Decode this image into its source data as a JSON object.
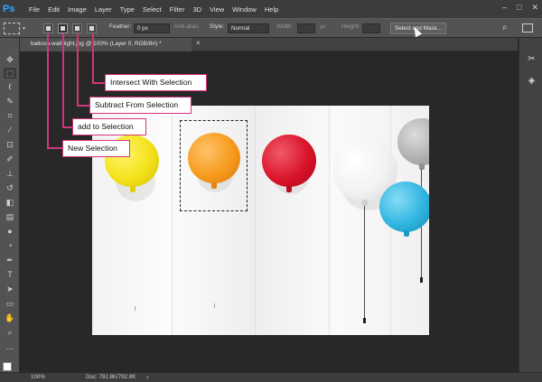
{
  "app": {
    "logo": "Ps"
  },
  "menus": [
    "File",
    "Edit",
    "Image",
    "Layer",
    "Type",
    "Select",
    "Filter",
    "3D",
    "View",
    "Window",
    "Help"
  ],
  "window_controls": [
    "minimize",
    "maximize",
    "close"
  ],
  "options": {
    "feather_label": "Feather:",
    "feather_value": "0 px",
    "antialias_label": "Anti-alias",
    "style_label": "Style:",
    "style_value": "Normal",
    "width_label": "Width:",
    "height_label": "Height:",
    "select_mask": "Select and Mask..."
  },
  "document_tab": {
    "title": "balloon-wall-light.jpg @ 100% (Layer 0, RGB/8#) *",
    "close": "×"
  },
  "status": {
    "zoom": "100%",
    "doc": "Doc: 792.8K/792.8K",
    "arrow": "›"
  },
  "callouts": {
    "intersect": "Intersect With Selection",
    "subtract": "Subtract From Selection",
    "add": "add to Selection",
    "new": "New Selection"
  },
  "colors": {
    "highlight": "#d4347c",
    "foreground": "#ffffff",
    "background": "#ffffff",
    "balloon_yellow": "#f3e21a",
    "balloon_orange": "#f79b1e",
    "balloon_red": "#d9132a",
    "balloon_white": "#f2f2f2",
    "balloon_blue": "#2fb5e0",
    "balloon_grey": "#aeb0b0"
  },
  "icons": {
    "tools": [
      "move-icon",
      "marquee-icon",
      "lasso-icon",
      "quick-select-icon",
      "crop-icon",
      "eyedropper-icon",
      "healing-icon",
      "brush-icon",
      "stamp-icon",
      "history-brush-icon",
      "eraser-icon",
      "gradient-icon",
      "blur-icon",
      "dodge-icon",
      "pen-icon",
      "type-icon",
      "path-select-icon",
      "rectangle-icon",
      "hand-icon",
      "zoom-icon",
      "more-tools-icon"
    ],
    "right_panel": [
      "tools-panel-icon",
      "layers-panel-icon"
    ]
  }
}
